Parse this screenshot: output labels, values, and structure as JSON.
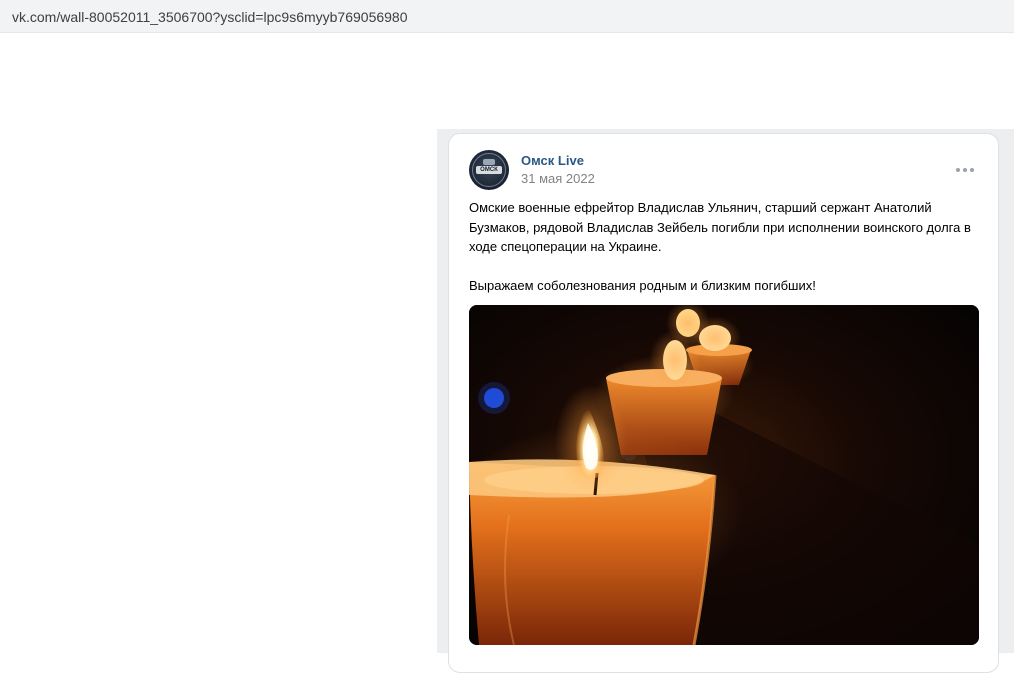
{
  "browser": {
    "url": "vk.com/wall-80052011_3506700?ysclid=lpc9s6myyb769056980"
  },
  "post": {
    "author": "Омск Live",
    "avatar_icon": "omsk-live-logo",
    "avatar_text": "ОМСК",
    "date": "31 мая 2022",
    "paragraphs": [
      "Омские военные ефрейтор Владислав Ульянич, старший сержант Анатолий Бузмаков, рядовой Владислав Зейбель погибли при исполнении воинского долга в ходе спецоперации на Украине.",
      "Выражаем соболезнования родным и близким погибших!"
    ],
    "image": "candles-in-the-dark-photo"
  },
  "colors": {
    "link": "#2a5885",
    "muted": "#828282",
    "feed_background": "#edeef0"
  }
}
